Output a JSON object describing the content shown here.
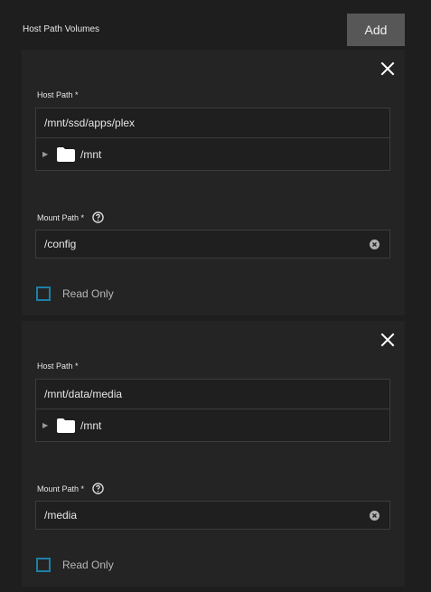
{
  "section": {
    "title": "Host Path Volumes",
    "add_label": "Add"
  },
  "volumes": [
    {
      "host_path_label": "Host Path *",
      "host_path_value": "/mnt/ssd/apps/plex",
      "tree_root": "/mnt",
      "mount_path_label": "Mount Path *",
      "mount_path_value": "/config",
      "read_only_label": "Read Only",
      "read_only_checked": false
    },
    {
      "host_path_label": "Host Path *",
      "host_path_value": "/mnt/data/media",
      "tree_root": "/mnt",
      "mount_path_label": "Mount Path *",
      "mount_path_value": "/media",
      "read_only_label": "Read Only",
      "read_only_checked": false
    }
  ],
  "colors": {
    "background": "#1e1e1e",
    "card": "#242424",
    "button": "#575757",
    "checkbox_border": "#1e7fa6"
  },
  "icons": [
    "close-icon",
    "folder-icon",
    "help-icon",
    "clear-icon",
    "expand-arrow-icon"
  ]
}
